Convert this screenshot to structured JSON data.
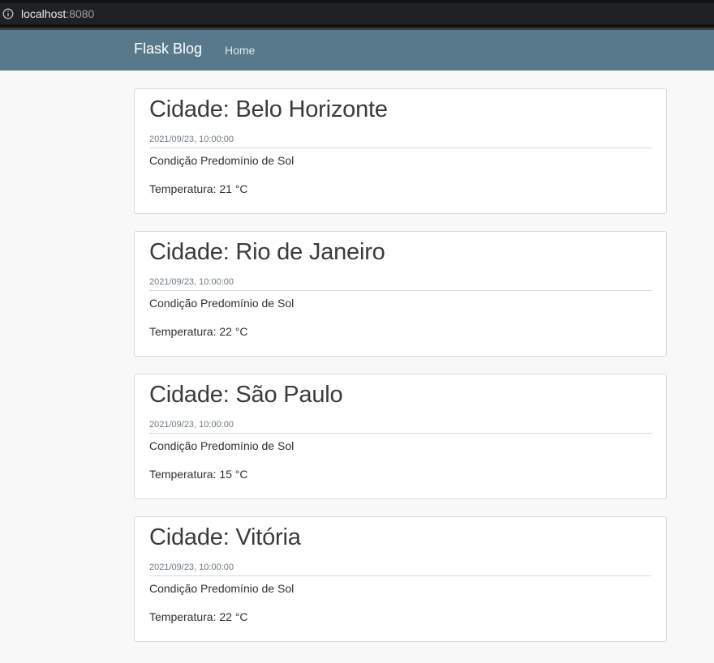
{
  "browser": {
    "url_host": "localhost",
    "url_port": ":8080"
  },
  "navbar": {
    "brand": "Flask Blog",
    "home": "Home"
  },
  "posts": [
    {
      "title": "Cidade: Belo Horizonte",
      "date": "2021/09/23, 10:00:00",
      "condition": "Condição Predomínio de Sol",
      "temperature": "Temperatura: 21 °C"
    },
    {
      "title": "Cidade: Rio de Janeiro",
      "date": "2021/09/23, 10:00:00",
      "condition": "Condição Predomínio de Sol",
      "temperature": "Temperatura: 22 °C"
    },
    {
      "title": "Cidade: São Paulo",
      "date": "2021/09/23, 10:00:00",
      "condition": "Condição Predomínio de Sol",
      "temperature": "Temperatura: 15 °C"
    },
    {
      "title": "Cidade: Vitória",
      "date": "2021/09/23, 10:00:00",
      "condition": "Condição Predomínio de Sol",
      "temperature": "Temperatura: 22 °C"
    }
  ],
  "colors": {
    "navbar": "#58798b",
    "page_background": "#f8f8f8"
  }
}
